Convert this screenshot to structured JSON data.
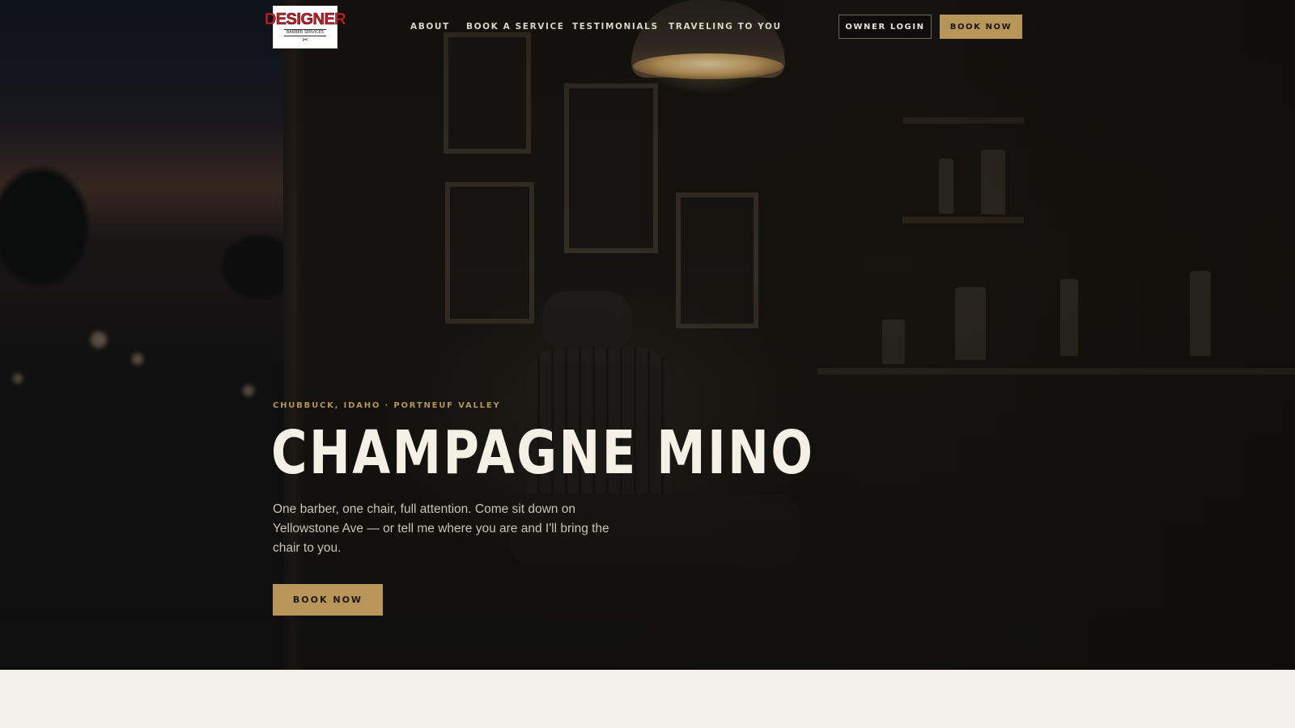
{
  "brand": {
    "logo_word": "DESIGNER",
    "logo_sub": "BARBER SERVICES",
    "logo_icon": "scissors-icon"
  },
  "nav": {
    "links": [
      "ABOUT",
      "BOOK A SERVICE",
      "TESTIMONIALS",
      "TRAVELING TO YOU"
    ],
    "owner_login": "OWNER LOGIN",
    "book_now": "BOOK NOW"
  },
  "hero": {
    "eyebrow": "CHUBBUCK, IDAHO · PORTNEUF VALLEY",
    "title": "CHAMPAGNE MINO",
    "lede": "One barber, one chair, full attention. Come sit down on Yellowstone Ave — or tell me where you are and I'll bring the chair to you.",
    "cta": "BOOK NOW"
  },
  "colors": {
    "accent_gold": "#b8965a",
    "hero_dark": "#151310",
    "cream": "#f3f0e9",
    "logo_red": "#c4202a"
  }
}
